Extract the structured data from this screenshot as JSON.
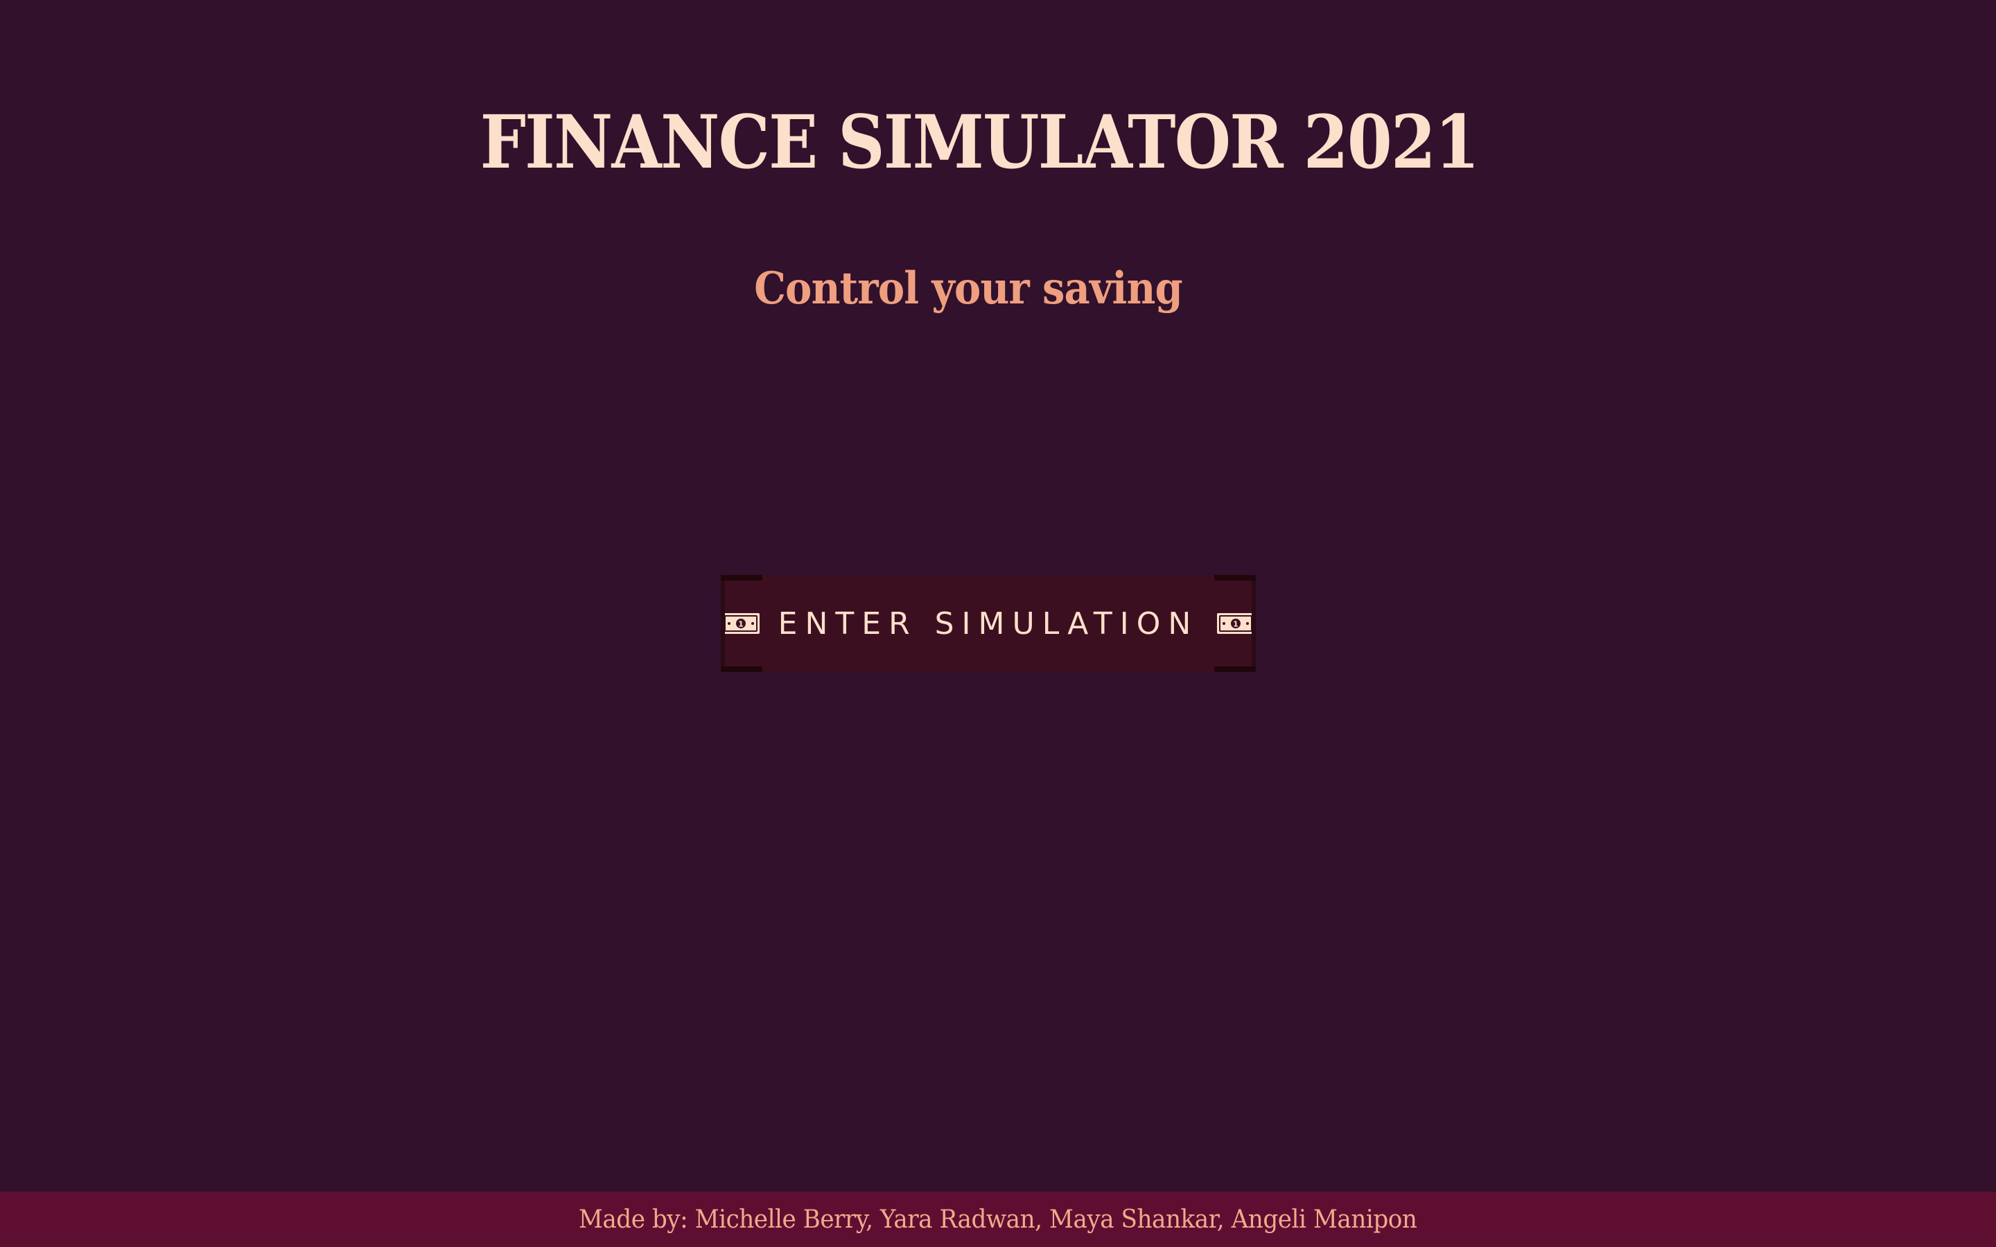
{
  "header": {
    "title": "FINANCE SIMULATOR 2021",
    "subtitle": "Control your saving"
  },
  "main": {
    "enter_button_label": "ENTER SIMULATION",
    "button_icon": "money-bill-icon"
  },
  "footer": {
    "credits": "Made by: Michelle Berry, Yara Radwan, Maya Shankar, Angeli Manipon"
  },
  "colors": {
    "background": "#31112c",
    "title": "#fde0cb",
    "subtitle": "#ef9f7f",
    "button_background": "#3c0f20",
    "footer_background": "#5e0f31",
    "footer_text": "#f4a98c"
  }
}
